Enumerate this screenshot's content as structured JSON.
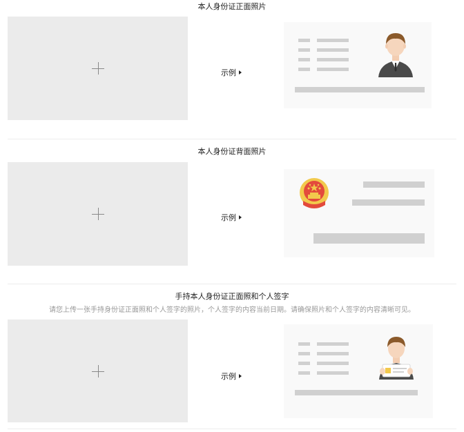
{
  "sections": [
    {
      "title": "本人身份证正面照片",
      "example_label": "示例"
    },
    {
      "title": "本人身份证背面照片",
      "example_label": "示例"
    },
    {
      "title": "手持本人身份证正面照和个人签字",
      "subtitle": "请您上传一张手持身份证正面照和个人签字的照片，个人签字的内容当前日期。请确保照片和个人签字的内容清晰可见。",
      "example_label": "示例"
    }
  ],
  "icons": {
    "upload": "plus-icon",
    "example_arrow": "triangle-right-icon"
  },
  "colors": {
    "upload_bg": "#ebebeb",
    "card_bg": "#f9f9f9",
    "placeholder_bar": "#d0d0d0",
    "emblem_red": "#e34a3c",
    "emblem_gold": "#f2c94c"
  }
}
